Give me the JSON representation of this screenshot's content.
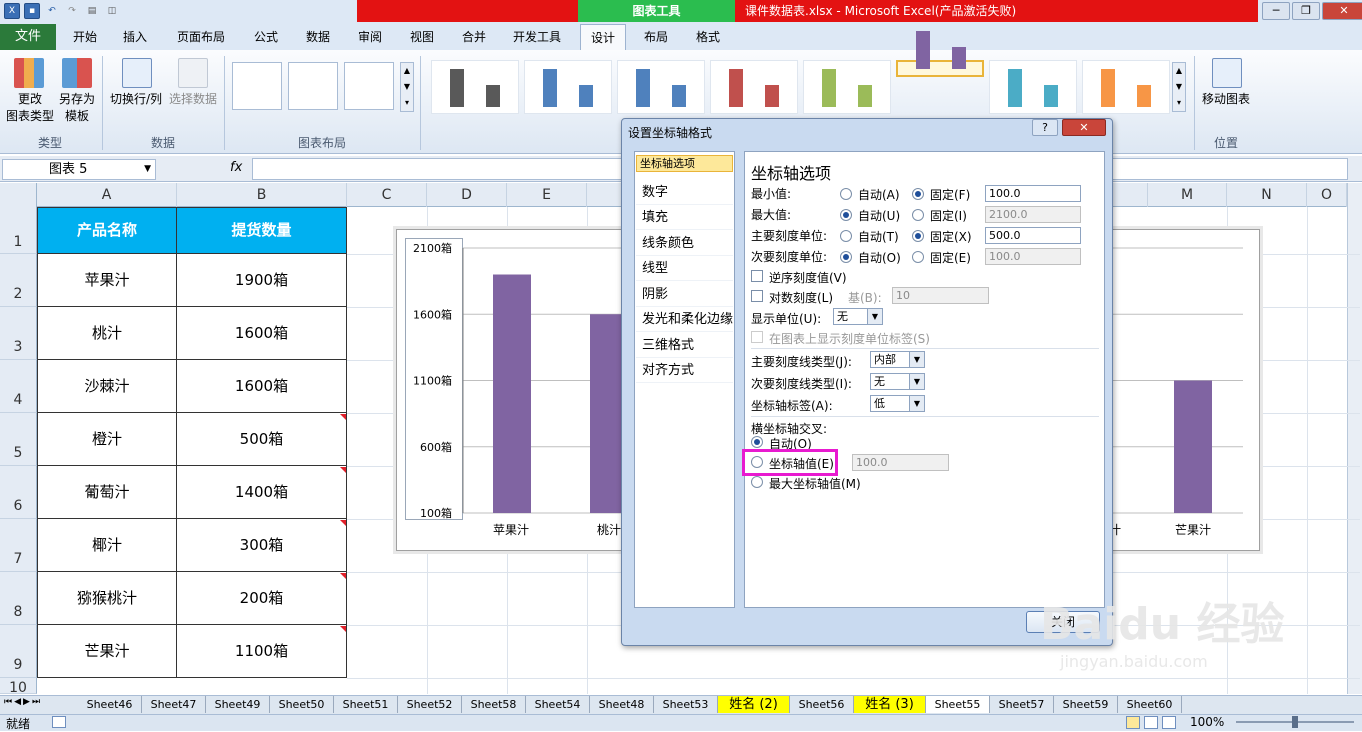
{
  "window": {
    "contextual_tools": "图表工具",
    "title": "课件数据表.xlsx - Microsoft Excel(产品激活失败)",
    "win_minimize": "─",
    "win_restore": "❐",
    "win_close": "✕"
  },
  "ribbon_tabs": {
    "file": "文件",
    "home": "开始",
    "insert": "插入",
    "page_layout": "页面布局",
    "formulas": "公式",
    "data": "数据",
    "review": "审阅",
    "view": "视图",
    "merge": "合并",
    "developer": "开发工具",
    "design": "设计",
    "layout": "布局",
    "format": "格式"
  },
  "ribbon": {
    "change_type": "更改\n图表类型",
    "change_type_line1": "更改",
    "change_type_line2": "图表类型",
    "save_template_line1": "另存为",
    "save_template_line2": "模板",
    "switch_rowcol": "切换行/列",
    "select_data": "选择数据",
    "group_type": "类型",
    "group_data": "数据",
    "group_layout": "图表布局",
    "move_chart": "移动图表",
    "group_location": "位置",
    "style_colors": [
      "#595959",
      "#4f81bd",
      "#4f81bd",
      "#c0504d",
      "#9bbb59",
      "#8064a2",
      "#4bacc6",
      "#f79646"
    ]
  },
  "formula_bar": {
    "name_box": "图表 5",
    "fx": "fx"
  },
  "columns": [
    "A",
    "B",
    "C",
    "D",
    "E",
    "M",
    "N",
    "O"
  ],
  "rows": [
    "1",
    "2",
    "3",
    "4",
    "5",
    "6",
    "7",
    "8",
    "9",
    "10"
  ],
  "table": {
    "headers": [
      "产品名称",
      "提货数量"
    ],
    "rows": [
      [
        "苹果汁",
        "1900箱"
      ],
      [
        "桃汁",
        "1600箱"
      ],
      [
        "沙棘汁",
        "1600箱"
      ],
      [
        "橙汁",
        "500箱"
      ],
      [
        "葡萄汁",
        "1400箱"
      ],
      [
        "椰汁",
        "300箱"
      ],
      [
        "猕猴桃汁",
        "200箱"
      ],
      [
        "芒果汁",
        "1100箱"
      ]
    ]
  },
  "chart_data": {
    "type": "bar",
    "categories": [
      "苹果汁",
      "桃汁",
      "芒果汁"
    ],
    "values": [
      1900,
      1600,
      1100
    ],
    "y_ticks": [
      "2100箱",
      "1600箱",
      "1100箱",
      "600箱",
      "100箱"
    ],
    "ylim": [
      100,
      2100
    ],
    "ymajor": 500,
    "bar_color": "#8064a2",
    "x_labels": [
      "苹果汁",
      "桃汁",
      "汁",
      "芒果汁"
    ]
  },
  "dialog": {
    "title": "设置坐标轴格式",
    "help": "?",
    "close_x": "✕",
    "nav": [
      "坐标轴选项",
      "数字",
      "填充",
      "线条颜色",
      "线型",
      "阴影",
      "发光和柔化边缘",
      "三维格式",
      "对齐方式"
    ],
    "section_title": "坐标轴选项",
    "min_label": "最小值:",
    "max_label": "最大值:",
    "major_label": "主要刻度单位:",
    "minor_label": "次要刻度单位:",
    "auto_a": "自动(A)",
    "fixed_f": "固定(F)",
    "auto_u": "自动(U)",
    "fixed_i": "固定(I)",
    "auto_t": "自动(T)",
    "fixed_x": "固定(X)",
    "auto_o": "自动(O)",
    "fixed_e": "固定(E)",
    "min_value": "100.0",
    "max_value": "2100.0",
    "major_value": "500.0",
    "minor_value": "100.0",
    "reverse": "逆序刻度值(V)",
    "log": "对数刻度(L)",
    "base_label": "基(B):",
    "base_value": "10",
    "display_unit_label": "显示单位(U):",
    "display_unit_value": "无",
    "show_unit_label": "在图表上显示刻度单位标签(S)",
    "major_tick_label": "主要刻度线类型(J):",
    "major_tick_value": "内部",
    "minor_tick_label": "次要刻度线类型(I):",
    "minor_tick_value": "无",
    "axis_labels_label": "坐标轴标签(A):",
    "axis_labels_value": "低",
    "crosses_title": "横坐标轴交叉:",
    "cross_auto": "自动(O)",
    "cross_value": "坐标轴值(E)",
    "cross_value_input": "100.0",
    "cross_max": "最大坐标轴值(M)",
    "close_button": "关闭"
  },
  "sheet_tabs": [
    "Sheet46",
    "Sheet47",
    "Sheet49",
    "Sheet50",
    "Sheet51",
    "Sheet52",
    "Sheet58",
    "Sheet54",
    "Sheet48",
    "Sheet53",
    "姓名 (2)",
    "Sheet56",
    "姓名 (3)",
    "Sheet55",
    "Sheet57",
    "Sheet59",
    "Sheet60"
  ],
  "status": {
    "ready": "就绪",
    "zoom": "100%"
  },
  "watermark": "Baidu 经验",
  "watermark_url": "jingyan.baidu.com"
}
